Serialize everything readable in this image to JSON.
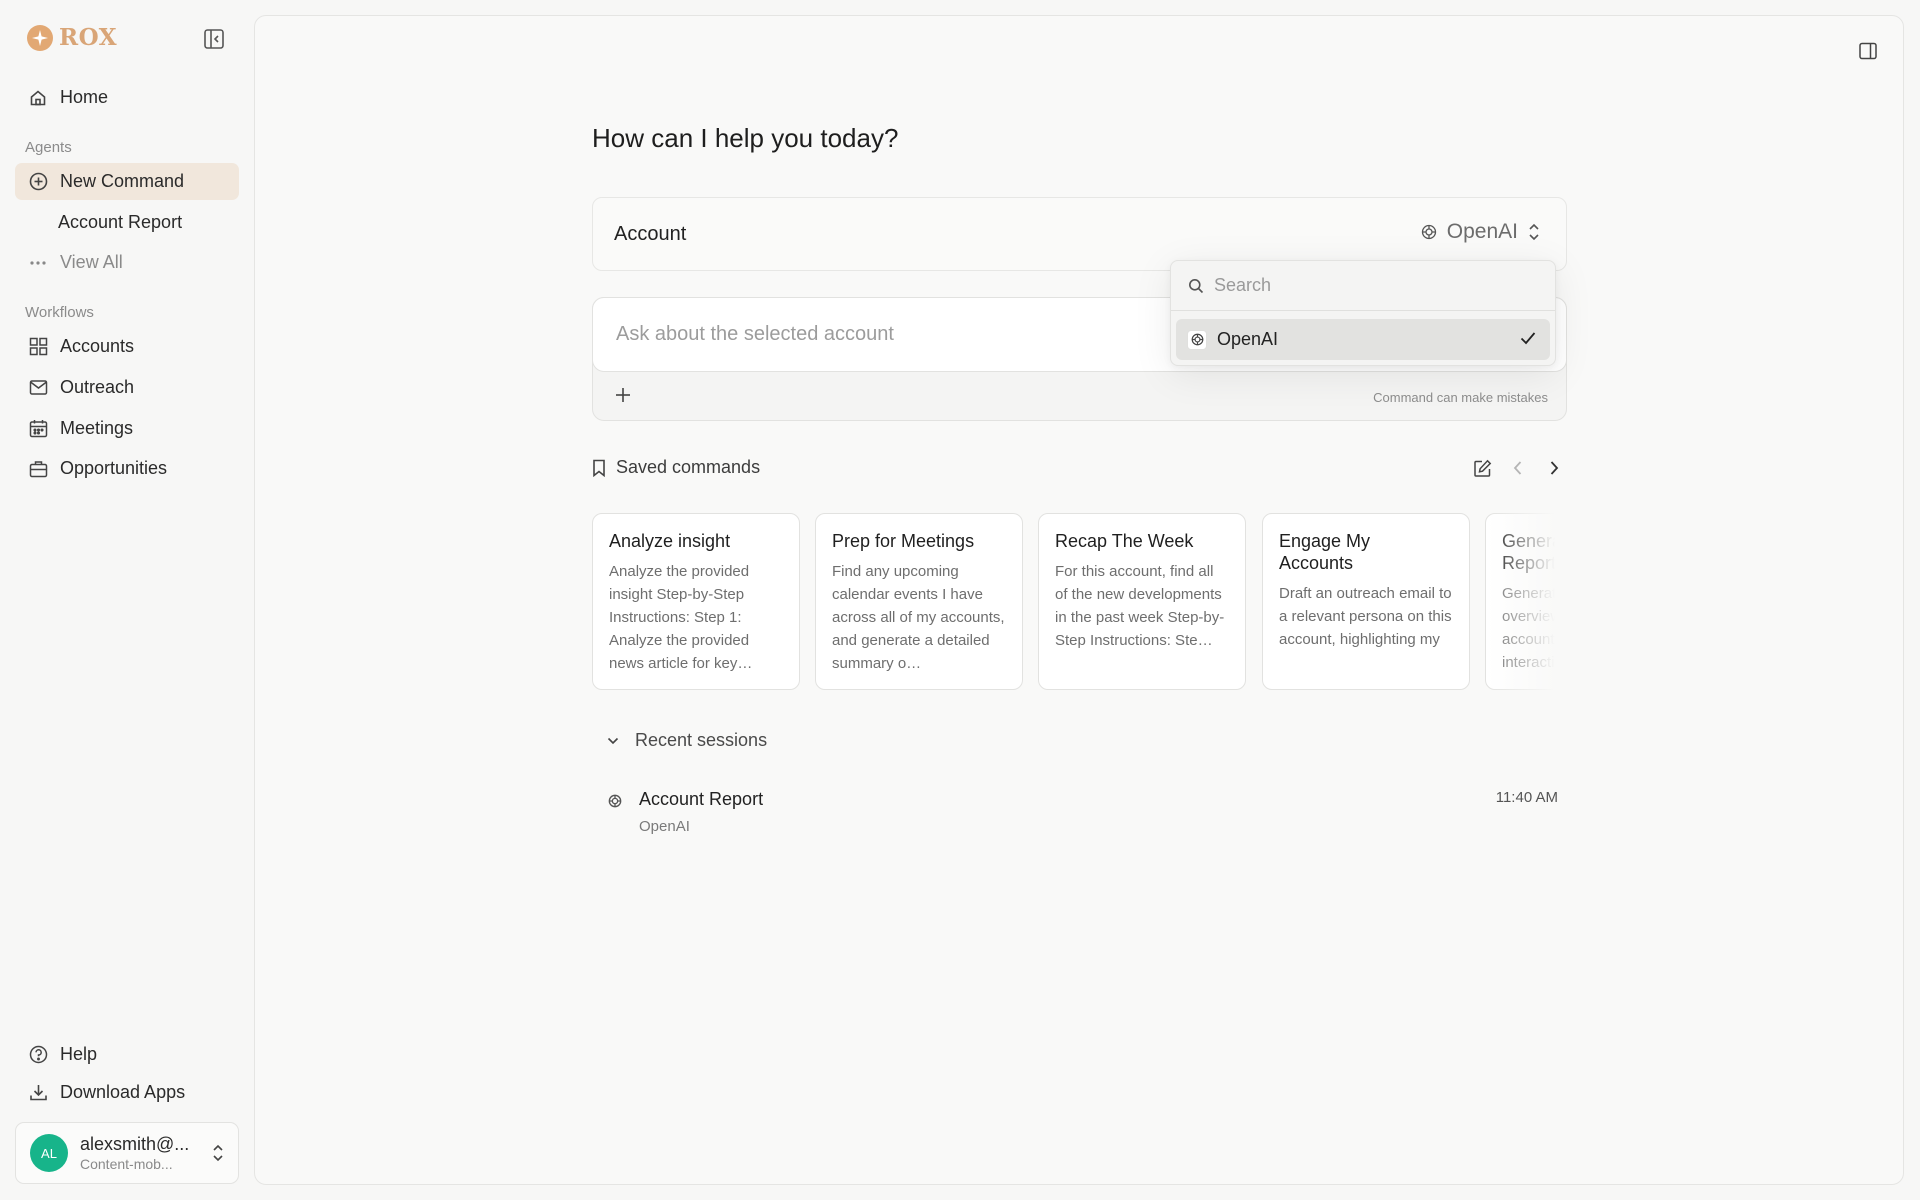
{
  "app": {
    "brand": "ROX"
  },
  "sidebar": {
    "home_label": "Home",
    "agents_label": "Agents",
    "new_command_label": "New Command",
    "account_report_label": "Account Report",
    "view_all_label": "View All",
    "workflows_label": "Workflows",
    "workflows": [
      {
        "label": "Accounts",
        "icon": "grid-icon"
      },
      {
        "label": "Outreach",
        "icon": "mail-icon"
      },
      {
        "label": "Meetings",
        "icon": "calendar-icon"
      },
      {
        "label": "Opportunities",
        "icon": "briefcase-icon"
      }
    ],
    "help_label": "Help",
    "download_label": "Download Apps",
    "user": {
      "initials": "AL",
      "name": "alexsmith@...",
      "org": "Content-mob..."
    }
  },
  "main": {
    "title": "How can I help you today?",
    "account_label": "Account",
    "selected_account": "OpenAI",
    "composer": {
      "placeholder": "Ask about the selected account",
      "disclaimer": "Command can make mistakes"
    },
    "dropdown": {
      "search_placeholder": "Search",
      "options": [
        {
          "label": "OpenAI",
          "selected": true
        }
      ]
    },
    "saved": {
      "label": "Saved commands",
      "cards": [
        {
          "title": "Analyze insight",
          "desc": "Analyze the provided insight Step-by-Step Instructions: Step 1: Analyze the provided news article for key…"
        },
        {
          "title": "Prep for Meetings",
          "desc": "Find any upcoming calendar events I have across all of my accounts, and generate a detailed summary o…"
        },
        {
          "title": "Recap The Week",
          "desc": "For this account, find all of the new developments in the past week Step-by-Step Instructions: Ste…"
        },
        {
          "title": "Engage My Accounts",
          "desc": "Draft an outreach email to a relevant persona on this account, highlighting my"
        },
        {
          "title": "Generate Report",
          "desc": "Generate overview account interaction"
        }
      ]
    },
    "recent": {
      "label": "Recent sessions",
      "sessions": [
        {
          "title": "Account Report",
          "subtitle": "OpenAI",
          "time": "11:40 AM"
        }
      ]
    }
  },
  "colors": {
    "accent": "#e2a873",
    "active_bg": "#f1e7dc",
    "avatar": "#17b48a"
  }
}
